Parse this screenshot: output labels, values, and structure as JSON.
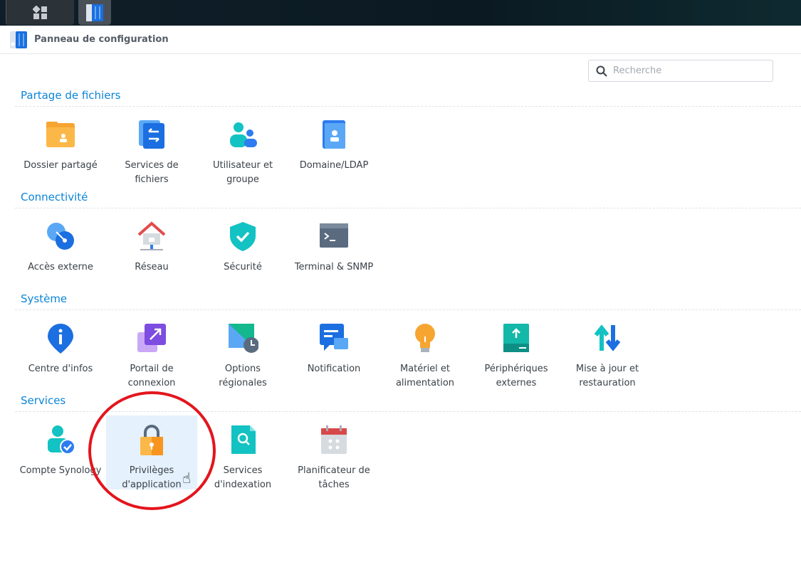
{
  "window": {
    "title": "Panneau de configuration"
  },
  "search": {
    "placeholder": "Recherche",
    "value": ""
  },
  "sections": [
    {
      "title": "Partage de fichiers",
      "items": [
        {
          "l1": "Dossier partagé",
          "l2": "",
          "icon": "shared-folder-icon"
        },
        {
          "l1": "Services de",
          "l2": "fichiers",
          "icon": "file-services-icon"
        },
        {
          "l1": "Utilisateur et",
          "l2": "groupe",
          "icon": "user-group-icon"
        },
        {
          "l1": "Domaine/LDAP",
          "l2": "",
          "icon": "domain-ldap-icon"
        }
      ]
    },
    {
      "title": "Connectivité",
      "items": [
        {
          "l1": "Accès externe",
          "l2": "",
          "icon": "external-access-icon"
        },
        {
          "l1": "Réseau",
          "l2": "",
          "icon": "network-icon"
        },
        {
          "l1": "Sécurité",
          "l2": "",
          "icon": "security-shield-icon"
        },
        {
          "l1": "Terminal & SNMP",
          "l2": "",
          "icon": "terminal-icon"
        }
      ]
    },
    {
      "title": "Système",
      "items": [
        {
          "l1": "Centre d'infos",
          "l2": "",
          "icon": "info-center-icon"
        },
        {
          "l1": "Portail de",
          "l2": "connexion",
          "icon": "login-portal-icon"
        },
        {
          "l1": "Options",
          "l2": "régionales",
          "icon": "regional-options-icon"
        },
        {
          "l1": "Notification",
          "l2": "",
          "icon": "notification-icon"
        },
        {
          "l1": "Matériel et",
          "l2": "alimentation",
          "icon": "hardware-power-icon"
        },
        {
          "l1": "Périphériques",
          "l2": "externes",
          "icon": "external-devices-icon"
        },
        {
          "l1": "Mise à jour et",
          "l2": "restauration",
          "icon": "update-restore-icon"
        }
      ]
    },
    {
      "title": "Services",
      "items": [
        {
          "l1": "Compte Synology",
          "l2": "",
          "icon": "synology-account-icon"
        },
        {
          "l1": "Privilèges",
          "l2": "d'application",
          "icon": "application-privileges-icon",
          "highlighted": true
        },
        {
          "l1": "Services",
          "l2": "d'indexation",
          "icon": "indexing-service-icon"
        },
        {
          "l1": "Planificateur de",
          "l2": "tâches",
          "icon": "task-scheduler-icon"
        }
      ]
    }
  ],
  "colors": {
    "accent": "#0b85d8",
    "annotation": "#e3151d",
    "highlight": "#e5f1fc"
  }
}
